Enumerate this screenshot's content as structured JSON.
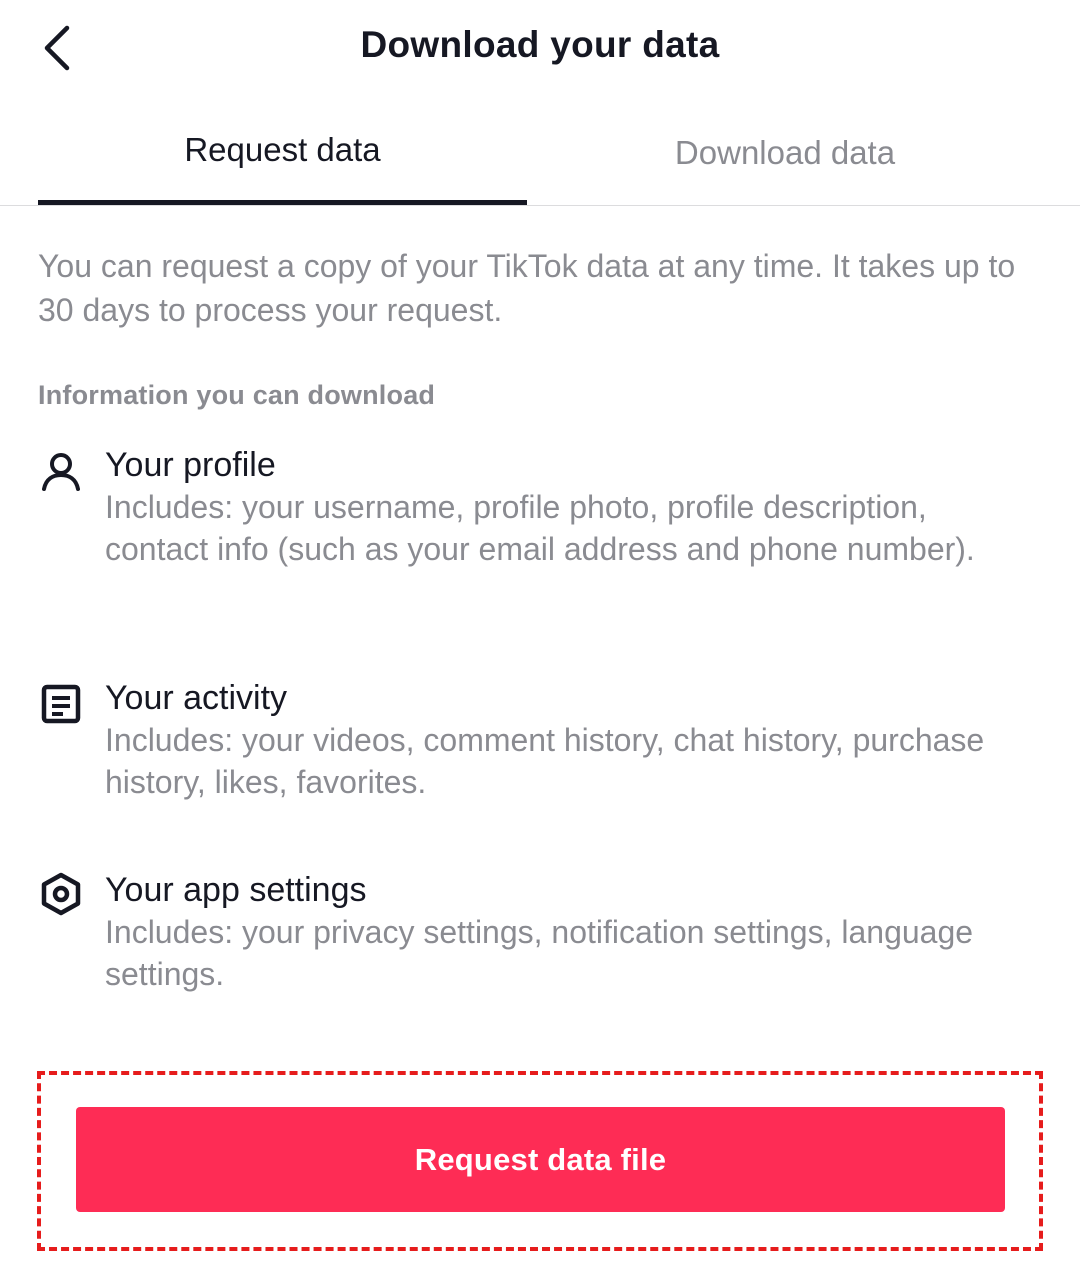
{
  "header": {
    "title": "Download your data",
    "back_icon": "chevron-left-icon"
  },
  "tabs": [
    {
      "label": "Request data",
      "active": true
    },
    {
      "label": "Download data",
      "active": false
    }
  ],
  "intro": "You can request a copy of your TikTok data at any time. It takes up to 30 days to process your request.",
  "section_label": "Information you can download",
  "items": [
    {
      "icon": "person-icon",
      "title": "Your profile",
      "description": "Includes: your username, profile photo, profile description, contact info (such as your email address and phone number)."
    },
    {
      "icon": "document-icon",
      "title": "Your activity",
      "description": "Includes: your videos, comment history, chat history, purchase history, likes, favorites."
    },
    {
      "icon": "settings-hexagon-icon",
      "title": "Your app settings",
      "description": "Includes: your privacy settings, notification settings, language settings."
    }
  ],
  "primary_button": {
    "label": "Request data file"
  },
  "colors": {
    "accent": "#fe2c55",
    "text_primary": "#161823",
    "text_secondary": "#8a8b91",
    "highlight": "#e61c1c"
  }
}
